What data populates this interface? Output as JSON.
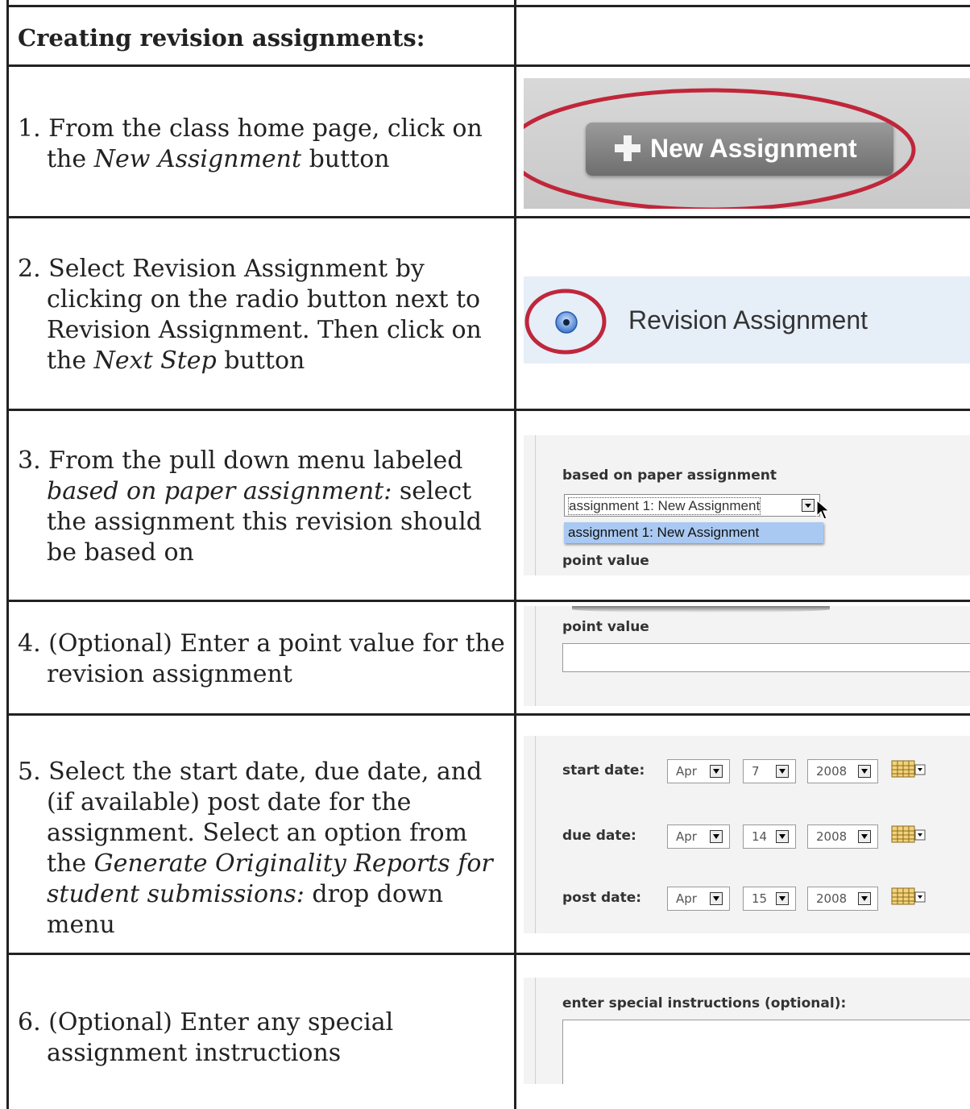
{
  "table": {
    "heading": "Creating revision assignments:"
  },
  "steps": [
    {
      "prefix": "1. From the class home page, click on the",
      "em": "New Assignment",
      "suffix": " button"
    },
    {
      "prefix": "2. Select Revision Assignment by clicking on the radio button next to Revision Assignment. Then click on the ",
      "em": "Next Step",
      "suffix": " button"
    },
    {
      "prefix": "3. From the pull down menu labeled ",
      "em": "based on paper assignment:",
      "suffix": " select the assignment this revision should be based on"
    },
    {
      "prefix": "4. (Optional) Enter a point value for the revision assignment"
    },
    {
      "prefix": "5. Select the start date, due date, and (if available) post date for the assignment. Select an option from the ",
      "em": "Generate Originality Reports for student submissions:",
      "suffix": " drop down menu"
    },
    {
      "prefix": "6. (Optional) Enter any special assignment instructions"
    }
  ],
  "screens": {
    "new_assignment_button": "New Assignment",
    "radio_label": "Revision Assignment",
    "based_on_label": "based on paper assignment",
    "based_on_selected": "assignment 1: New Assignment",
    "based_on_option": "assignment 1: New Assignment",
    "point_value_label": "point value",
    "point_value_label_2": "point value",
    "dates": [
      {
        "label": "start date:",
        "month": "Apr",
        "day": "7",
        "year": "2008"
      },
      {
        "label": "due date:",
        "month": "Apr",
        "day": "14",
        "year": "2008"
      },
      {
        "label": "post date:",
        "month": "Apr",
        "day": "15",
        "year": "2008"
      }
    ],
    "instructions_label": "enter special instructions (optional):"
  },
  "colors": {
    "highlight_ring": "#c0263a",
    "option_highlight": "#a9c9f2",
    "radio_band": "#e6eef8",
    "button_gray": "#808080"
  }
}
